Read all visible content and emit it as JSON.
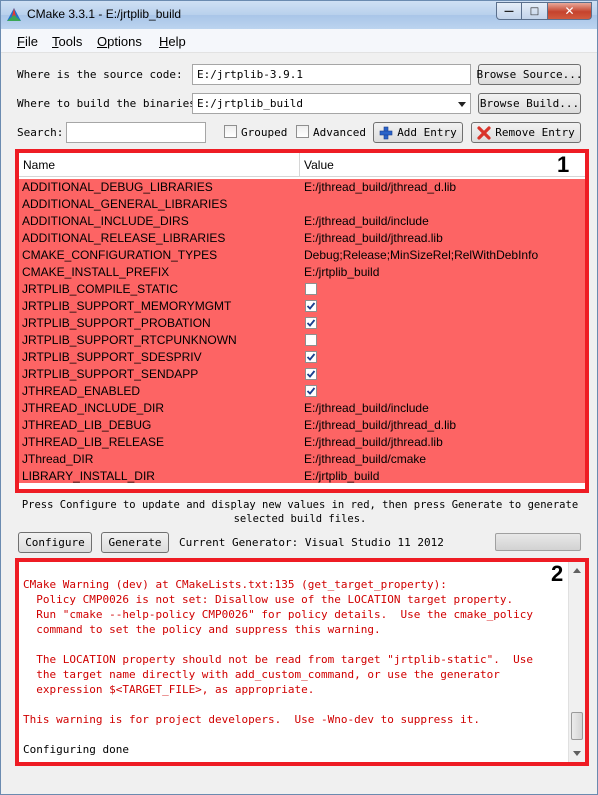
{
  "window": {
    "title": "CMake 3.3.1 - E:/jrtplib_build"
  },
  "menu": [
    {
      "key": "F",
      "rest": "ile"
    },
    {
      "key": "T",
      "rest": "ools"
    },
    {
      "key": "O",
      "rest": "ptions"
    },
    {
      "key": "H",
      "rest": "elp"
    }
  ],
  "source": {
    "label": "Where is the source code:",
    "value": "E:/jrtplib-3.9.1",
    "browse_label": "Browse Source..."
  },
  "build": {
    "label": "Where to build the binaries:",
    "value": "E:/jrtplib_build",
    "browse_label": "Browse Build..."
  },
  "search": {
    "label": "Search:",
    "value": ""
  },
  "options": {
    "grouped_label": "Grouped",
    "advanced_label": "Advanced"
  },
  "entries": {
    "add_label": "Add Entry",
    "remove_label": "Remove Entry"
  },
  "table": {
    "col_name": "Name",
    "col_value": "Value",
    "badge": "1",
    "rows": [
      {
        "name": "ADDITIONAL_DEBUG_LIBRARIES",
        "value": "E:/jthread_build/jthread_d.lib"
      },
      {
        "name": "ADDITIONAL_GENERAL_LIBRARIES",
        "value": ""
      },
      {
        "name": "ADDITIONAL_INCLUDE_DIRS",
        "value": "E:/jthread_build/include"
      },
      {
        "name": "ADDITIONAL_RELEASE_LIBRARIES",
        "value": "E:/jthread_build/jthread.lib"
      },
      {
        "name": "CMAKE_CONFIGURATION_TYPES",
        "value": "Debug;Release;MinSizeRel;RelWithDebInfo"
      },
      {
        "name": "CMAKE_INSTALL_PREFIX",
        "value": "E:/jrtplib_build"
      },
      {
        "name": "JRTPLIB_COMPILE_STATIC",
        "checked": false
      },
      {
        "name": "JRTPLIB_SUPPORT_MEMORYMGMT",
        "checked": true
      },
      {
        "name": "JRTPLIB_SUPPORT_PROBATION",
        "checked": true
      },
      {
        "name": "JRTPLIB_SUPPORT_RTCPUNKNOWN",
        "checked": false
      },
      {
        "name": "JRTPLIB_SUPPORT_SDESPRIV",
        "checked": true
      },
      {
        "name": "JRTPLIB_SUPPORT_SENDAPP",
        "checked": true
      },
      {
        "name": "JTHREAD_ENABLED",
        "checked": true
      },
      {
        "name": "JTHREAD_INCLUDE_DIR",
        "value": "E:/jthread_build/include"
      },
      {
        "name": "JTHREAD_LIB_DEBUG",
        "value": "E:/jthread_build/jthread_d.lib"
      },
      {
        "name": "JTHREAD_LIB_RELEASE",
        "value": "E:/jthread_build/jthread.lib"
      },
      {
        "name": "JThread_DIR",
        "value": "E:/jthread_build/cmake"
      },
      {
        "name": "LIBRARY_INSTALL_DIR",
        "value": "E:/jrtplib_build"
      }
    ]
  },
  "hint": {
    "line1": "Press Configure to update and display new values in red, then press Generate to generate",
    "line2": "selected build files."
  },
  "actions": {
    "configure_label": "Configure",
    "generate_label": "Generate",
    "generator_text": "Current Generator: Visual Studio 11 2012"
  },
  "output": {
    "badge": "2",
    "lines": [
      {
        "text": "CMake Warning (dev) at CMakeLists.txt:135 (get_target_property):",
        "color": "red"
      },
      {
        "text": "  Policy CMP0026 is not set: Disallow use of the LOCATION target property.",
        "color": "red"
      },
      {
        "text": "  Run \"cmake --help-policy CMP0026\" for policy details.  Use the cmake_policy",
        "color": "red"
      },
      {
        "text": "  command to set the policy and suppress this warning.",
        "color": "red"
      },
      {
        "text": "",
        "color": "red"
      },
      {
        "text": "  The LOCATION property should not be read from target \"jrtplib-static\".  Use",
        "color": "red"
      },
      {
        "text": "  the target name directly with add_custom_command, or use the generator",
        "color": "red"
      },
      {
        "text": "  expression $<TARGET_FILE>, as appropriate.",
        "color": "red"
      },
      {
        "text": "",
        "color": "red"
      },
      {
        "text": "This warning is for project developers.  Use -Wno-dev to suppress it.",
        "color": "red"
      },
      {
        "text": "",
        "color": "black"
      },
      {
        "text": "Configuring done",
        "color": "black"
      }
    ]
  },
  "colors": {
    "highlight_border": "#ee1c24",
    "new_entry_bg": "#fd6464",
    "warning_text": "#d00000"
  }
}
